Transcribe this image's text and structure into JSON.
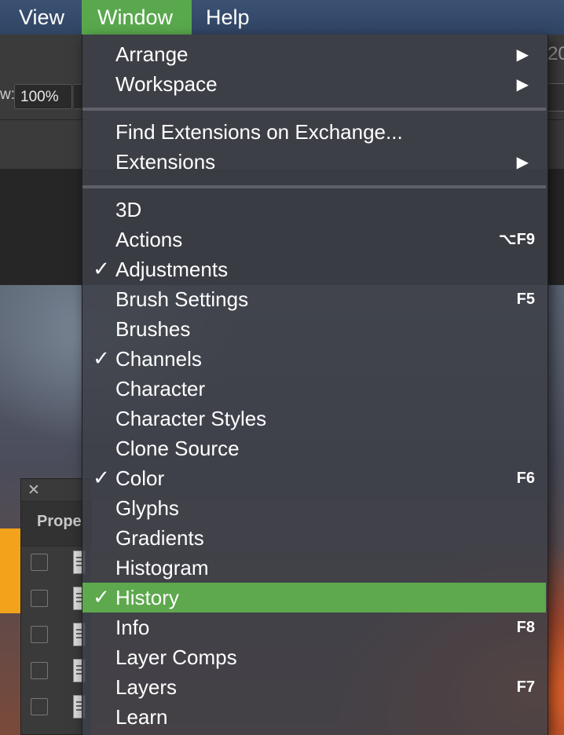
{
  "menubar": {
    "items": [
      {
        "label": "View"
      },
      {
        "label": "Window"
      },
      {
        "label": "Help"
      }
    ],
    "active_color": "#59a84d"
  },
  "toolbar": {
    "zoom_prefix": "w:",
    "zoom_value": "100%",
    "tab_peek": "20"
  },
  "properties_panel": {
    "close_glyph": "✕",
    "title": "Prope"
  },
  "window_menu": {
    "groups": [
      [
        {
          "label": "Arrange",
          "submenu": true
        },
        {
          "label": "Workspace",
          "submenu": true
        }
      ],
      [
        {
          "label": "Find Extensions on Exchange..."
        },
        {
          "label": "Extensions",
          "submenu": true
        }
      ],
      [
        {
          "label": "3D"
        },
        {
          "label": "Actions",
          "shortcut": "⌥F9"
        },
        {
          "label": "Adjustments",
          "checked": true
        },
        {
          "label": "Brush Settings",
          "shortcut": "F5"
        },
        {
          "label": "Brushes"
        },
        {
          "label": "Channels",
          "checked": true
        },
        {
          "label": "Character"
        },
        {
          "label": "Character Styles"
        },
        {
          "label": "Clone Source"
        },
        {
          "label": "Color",
          "checked": true,
          "shortcut": "F6"
        },
        {
          "label": "Glyphs"
        },
        {
          "label": "Gradients"
        },
        {
          "label": "Histogram"
        },
        {
          "label": "History",
          "checked": true,
          "highlighted": true
        },
        {
          "label": "Info",
          "shortcut": "F8"
        },
        {
          "label": "Layer Comps"
        },
        {
          "label": "Layers",
          "shortcut": "F7"
        },
        {
          "label": "Learn"
        }
      ]
    ],
    "check_glyph": "✓",
    "submenu_glyph": "▶",
    "highlight_color": "#5ea84e"
  }
}
